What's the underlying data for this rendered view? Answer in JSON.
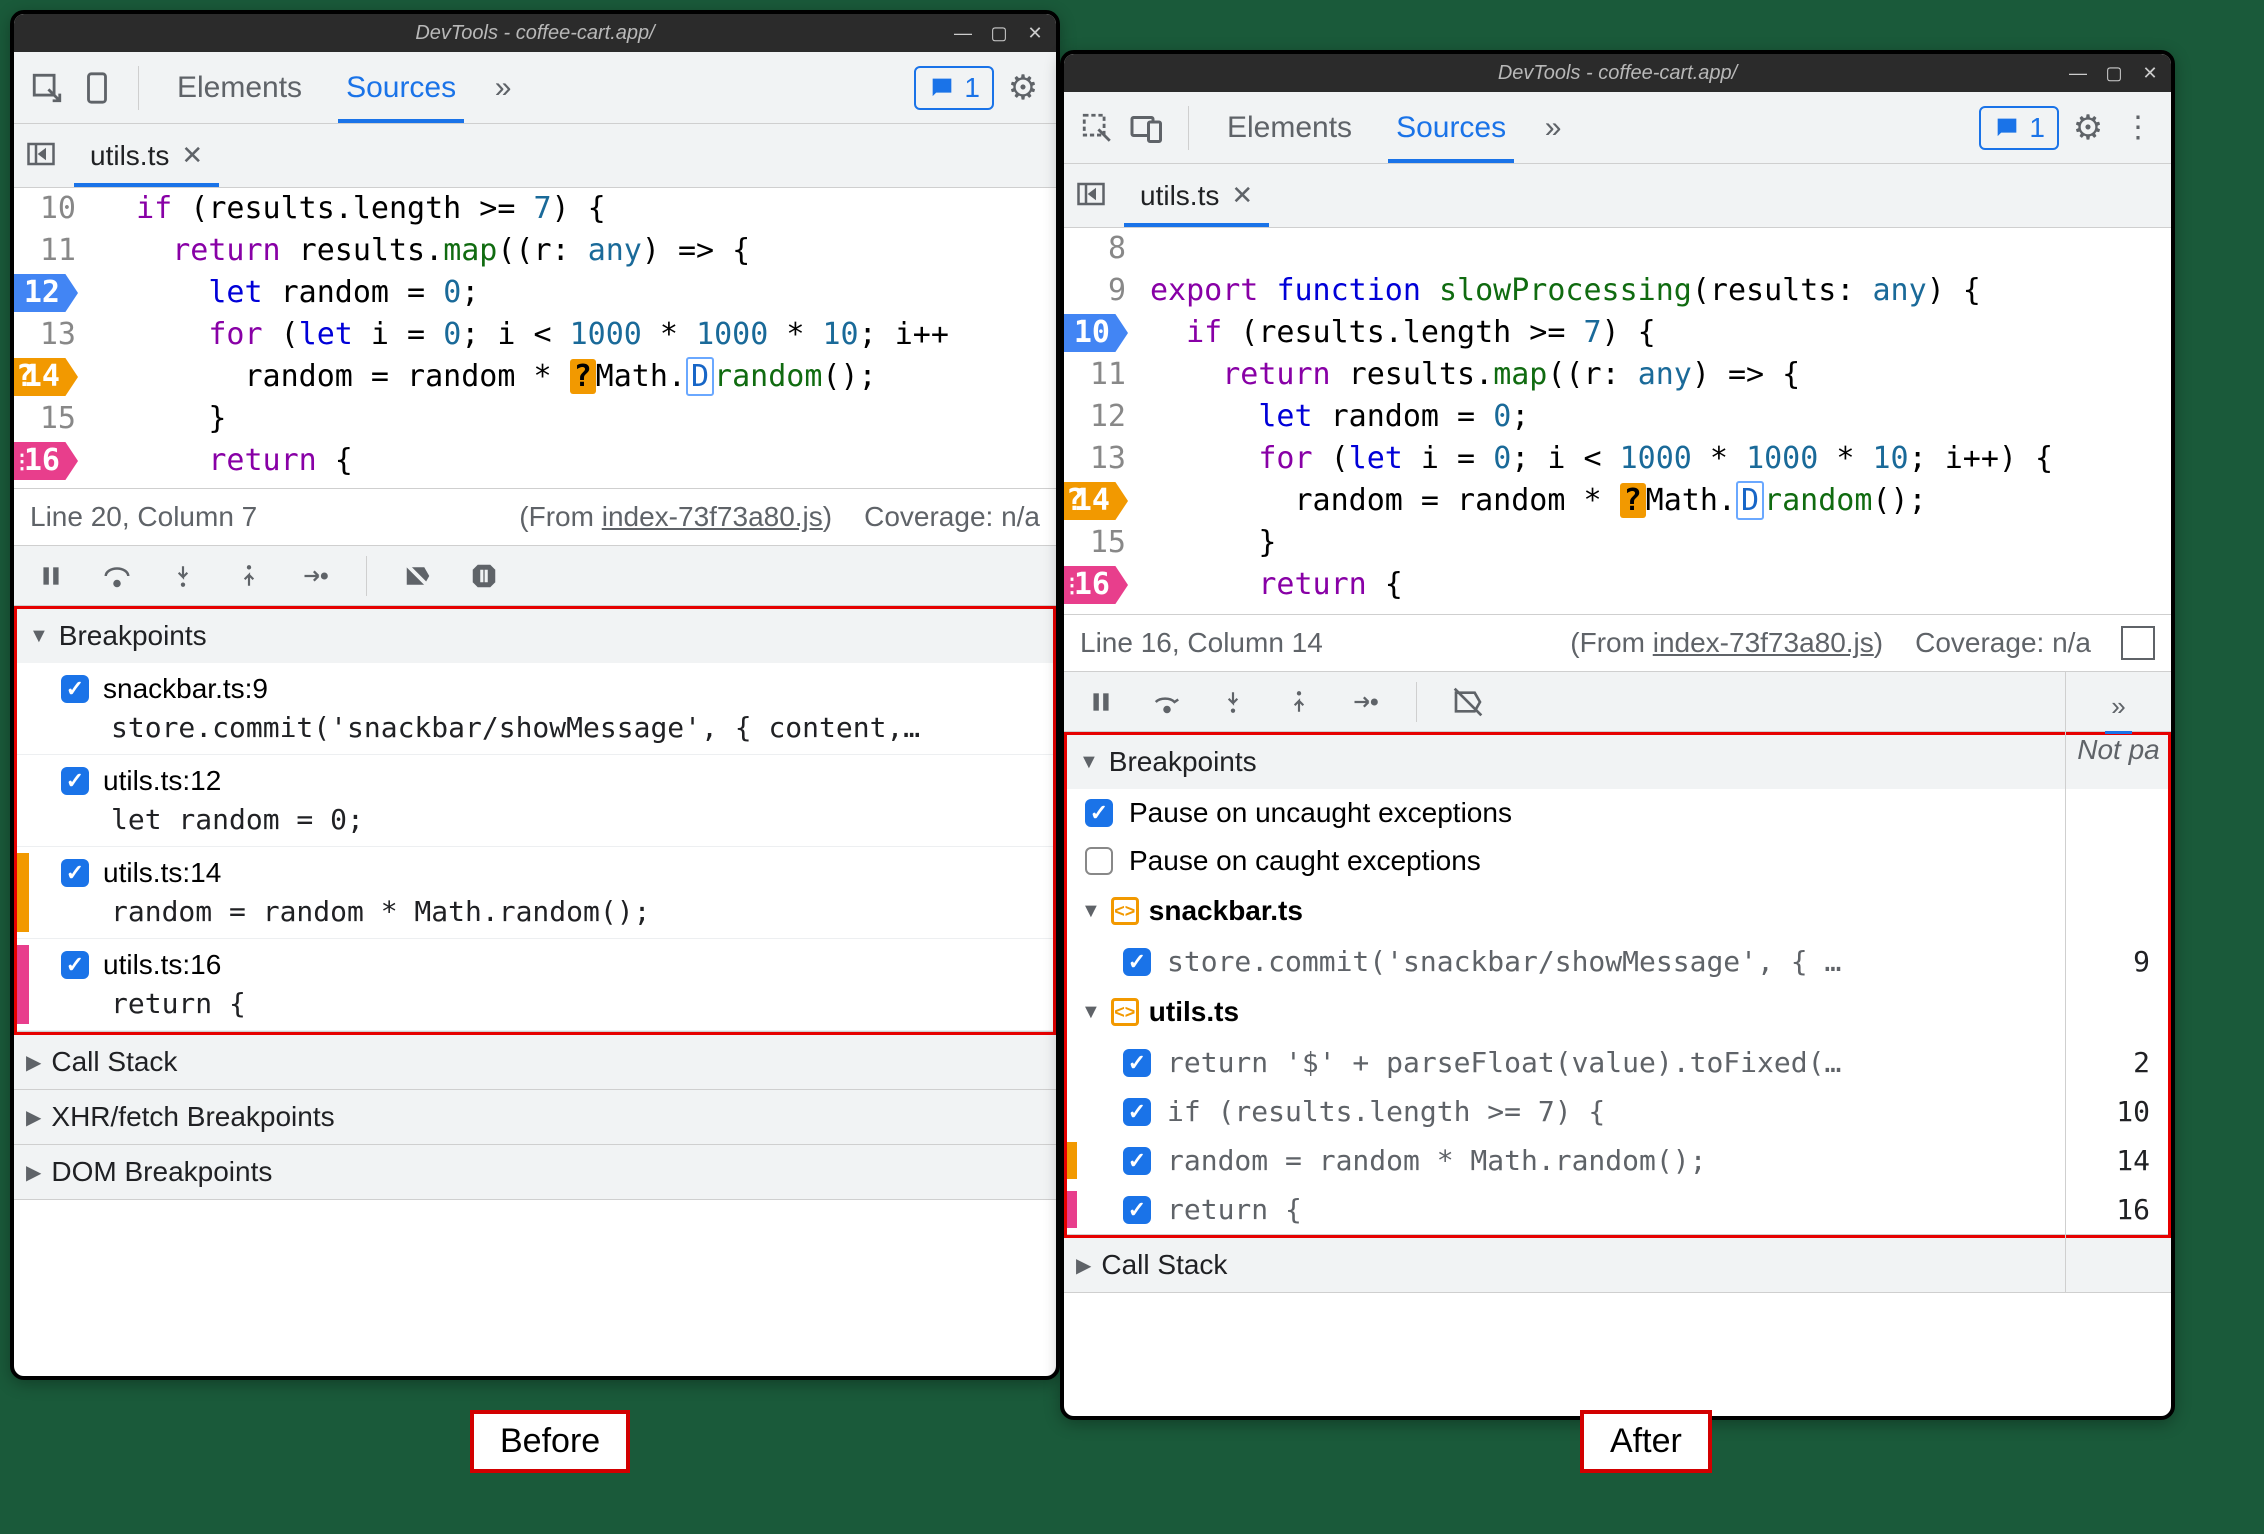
{
  "labels": {
    "before": "Before",
    "after": "After"
  },
  "before": {
    "title": "DevTools - coffee-cart.app/",
    "tabs": {
      "elements": "Elements",
      "sources": "Sources"
    },
    "issues_count": "1",
    "file": {
      "name": "utils.ts"
    },
    "code": {
      "lines": [
        {
          "n": "10",
          "html": "  <span class='kw'>if</span> (results.length &gt;= <span class='num'>7</span>) {"
        },
        {
          "n": "11",
          "html": "    <span class='kw'>return</span> results.<span class='fn'>map</span>((<span>r</span>: <span class='typ'>any</span>) =&gt; {"
        },
        {
          "n": "12",
          "bp": "blue",
          "html": "      <span class='kw2'>let</span> random = <span class='num'>0</span>;"
        },
        {
          "n": "13",
          "html": "      <span class='kw'>for</span> (<span class='kw2'>let</span> i = <span class='num'>0</span>; i &lt; <span class='num'>1000</span> * <span class='num'>1000</span> * <span class='num'>10</span>; i++"
        },
        {
          "n": "14",
          "bp": "orange",
          "q": true,
          "html": "        random = random * <span class='tok-badge-o'>?</span>Math.<span class='tok-badge-b'>D</span><span class='fn'>random</span>();"
        },
        {
          "n": "15",
          "html": "      }"
        },
        {
          "n": "16",
          "bp": "pink",
          "d": true,
          "html": "      <span class='kw'>return</span> {"
        }
      ]
    },
    "status": {
      "pos": "Line 20, Column 7",
      "from_prefix": "(From ",
      "from_link": "index-73f73a80.js",
      "from_suffix": ")",
      "coverage": "Coverage: n/a"
    },
    "panes": {
      "breakpoints": "Breakpoints",
      "items": [
        {
          "title": "snackbar.ts:9",
          "code": "store.commit('snackbar/showMessage', { content,…"
        },
        {
          "title": "utils.ts:12",
          "code": "let random = 0;"
        },
        {
          "title": "utils.ts:14",
          "code": "random = random * Math.random();",
          "edge": "orange"
        },
        {
          "title": "utils.ts:16",
          "code": "return {",
          "edge": "pink"
        }
      ],
      "callstack": "Call Stack",
      "xhr": "XHR/fetch Breakpoints",
      "dom": "DOM Breakpoints"
    }
  },
  "after": {
    "title": "DevTools - coffee-cart.app/",
    "tabs": {
      "elements": "Elements",
      "sources": "Sources"
    },
    "issues_count": "1",
    "file": {
      "name": "utils.ts"
    },
    "code": {
      "lines": [
        {
          "n": "8",
          "html": ""
        },
        {
          "n": "9",
          "html": "<span class='kw'>export</span> <span class='kw2'>function</span> <span class='fn'>slowProcessing</span>(results: <span class='typ'>any</span>) {"
        },
        {
          "n": "10",
          "bp": "blue",
          "html": "  <span class='kw'>if</span> (results.length &gt;= <span class='num'>7</span>) {"
        },
        {
          "n": "11",
          "html": "    <span class='kw'>return</span> results.<span class='fn'>map</span>((<span>r</span>: <span class='typ'>any</span>) =&gt; {"
        },
        {
          "n": "12",
          "html": "      <span class='kw2'>let</span> random = <span class='num'>0</span>;"
        },
        {
          "n": "13",
          "html": "      <span class='kw'>for</span> (<span class='kw2'>let</span> i = <span class='num'>0</span>; i &lt; <span class='num'>1000</span> * <span class='num'>1000</span> * <span class='num'>10</span>; i++) {"
        },
        {
          "n": "14",
          "bp": "orange",
          "q": true,
          "html": "        random = random * <span class='tok-badge-o'>?</span>Math.<span class='tok-badge-b'>D</span><span class='fn'>random</span>();"
        },
        {
          "n": "15",
          "html": "      }"
        },
        {
          "n": "16",
          "bp": "pink",
          "d": true,
          "html": "      <span class='kw'>return</span> {"
        }
      ]
    },
    "status": {
      "pos": "Line 16, Column 14",
      "from_prefix": "(From ",
      "from_link": "index-73f73a80.js",
      "from_suffix": ")",
      "coverage": "Coverage: n/a"
    },
    "side": {
      "notpaused": "Not pa"
    },
    "panes": {
      "breakpoints": "Breakpoints",
      "pause_uncaught": "Pause on uncaught exceptions",
      "pause_caught": "Pause on caught exceptions",
      "groups": [
        {
          "file": "snackbar.ts",
          "lines": [
            {
              "code": "store.commit('snackbar/showMessage', { …",
              "n": "9"
            }
          ]
        },
        {
          "file": "utils.ts",
          "lines": [
            {
              "code": "return '$' + parseFloat(value).toFixed(…",
              "n": "2"
            },
            {
              "code": "if (results.length >= 7) {",
              "n": "10"
            },
            {
              "code": "random = random * Math.random();",
              "n": "14",
              "edge": "orange"
            },
            {
              "code": "return {",
              "n": "16",
              "edge": "pink"
            }
          ]
        }
      ],
      "callstack": "Call Stack"
    }
  }
}
